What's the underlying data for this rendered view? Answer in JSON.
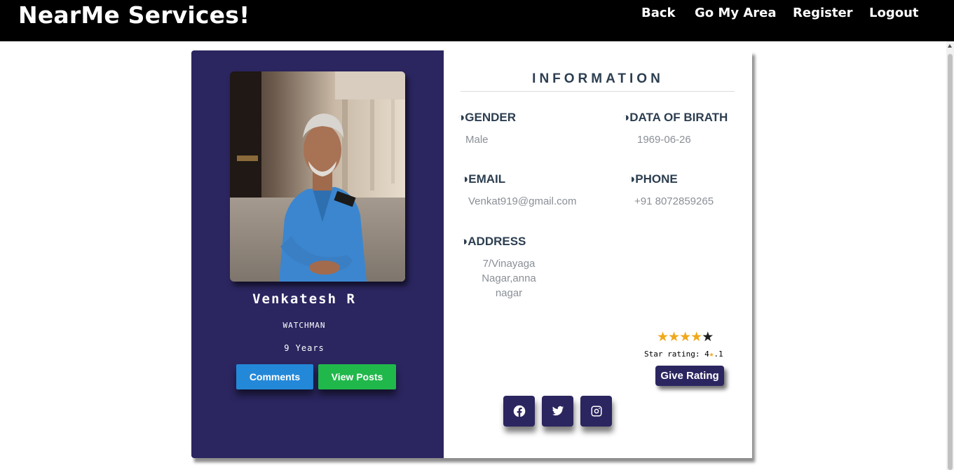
{
  "header": {
    "brand": "NearMe Services!",
    "nav": [
      "Back",
      "Go My Area",
      "Register",
      "Logout"
    ]
  },
  "profile": {
    "name": "Venkatesh R",
    "role": "WATCHMAN",
    "experience": "9 Years",
    "comments_label": "Comments",
    "posts_label": "View Posts"
  },
  "info": {
    "title": "INFORMATION",
    "gender_label": "◑GENDER",
    "gender": "Male",
    "dob_label": "◑DATA OF BIRATH",
    "dob": "1969-06-26",
    "email_label": "◑EMAIL",
    "email": "Venkat919@gmail.com",
    "phone_label": "◑PHONE",
    "phone": "+91 8072859265",
    "address_label": "◑ADDRESS",
    "address_lines": [
      "7/Vinayaga",
      "Nagar,anna",
      "nagar"
    ]
  },
  "rating": {
    "stars_filled": 4,
    "stars_total": 5,
    "text_prefix": "Star rating: 4",
    "text_suffix": ".1",
    "give_label": "Give Rating"
  },
  "social": [
    "facebook-icon",
    "twitter-icon",
    "instagram-icon"
  ],
  "colors": {
    "topbar": "#000000",
    "panel": "#2b2660",
    "comments": "#2488d8",
    "posts": "#20b84a",
    "star": "#f0a81a"
  }
}
